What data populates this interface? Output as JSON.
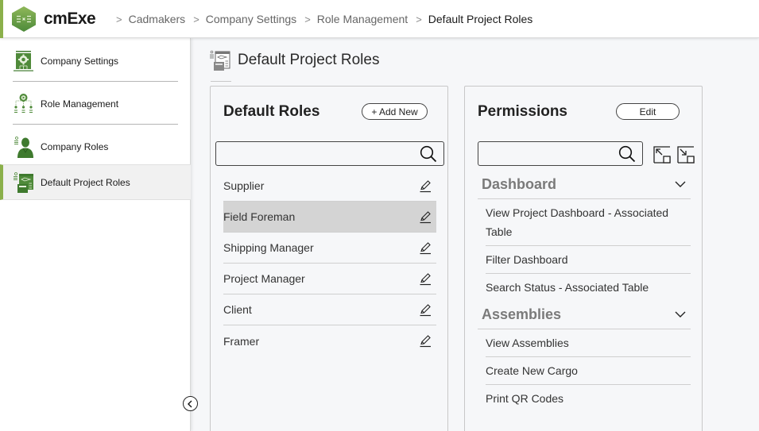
{
  "app": {
    "name": "cmExe",
    "accent_color": "#8bb04b",
    "logo_icon": "cmexe-hexagon-logo-icon"
  },
  "breadcrumb": [
    {
      "label": "Cadmakers"
    },
    {
      "label": "Company Settings"
    },
    {
      "label": "Role Management"
    },
    {
      "label": "Default Project Roles",
      "current": true
    }
  ],
  "sidebar": {
    "items": [
      {
        "label": "Company Settings",
        "icon": "company-settings-icon"
      },
      {
        "label": "Role Management",
        "icon": "role-management-icon"
      },
      {
        "label": "Company Roles",
        "icon": "company-roles-icon"
      },
      {
        "label": "Default Project Roles",
        "icon": "default-project-roles-icon",
        "active": true
      }
    ],
    "collapse_icon": "chevron-left-circle-icon"
  },
  "page": {
    "title": "Default Project Roles",
    "title_icon": "default-project-roles-icon"
  },
  "roles_panel": {
    "title": "Default Roles",
    "add_button": "+ Add New",
    "search_placeholder": "",
    "search_value": "",
    "roles": [
      {
        "name": "Supplier",
        "selected": false
      },
      {
        "name": "Field Foreman",
        "selected": true
      },
      {
        "name": "Shipping Manager",
        "selected": false
      },
      {
        "name": "Project Manager",
        "selected": false
      },
      {
        "name": "Client",
        "selected": false
      },
      {
        "name": "Framer",
        "selected": false
      }
    ]
  },
  "permissions_panel": {
    "title": "Permissions",
    "edit_button": "Edit",
    "search_placeholder": "",
    "search_value": "",
    "expand_all_icon": "expand-all-icon",
    "collapse_all_icon": "collapse-all-icon",
    "groups": [
      {
        "name": "Dashboard",
        "expanded": true,
        "permissions": [
          "View Project Dashboard - Associated Table",
          "Filter Dashboard",
          "Search Status - Associated Table"
        ]
      },
      {
        "name": "Assemblies",
        "expanded": true,
        "permissions": [
          "View Assemblies",
          "Create New Cargo",
          "Print QR Codes"
        ]
      }
    ]
  }
}
